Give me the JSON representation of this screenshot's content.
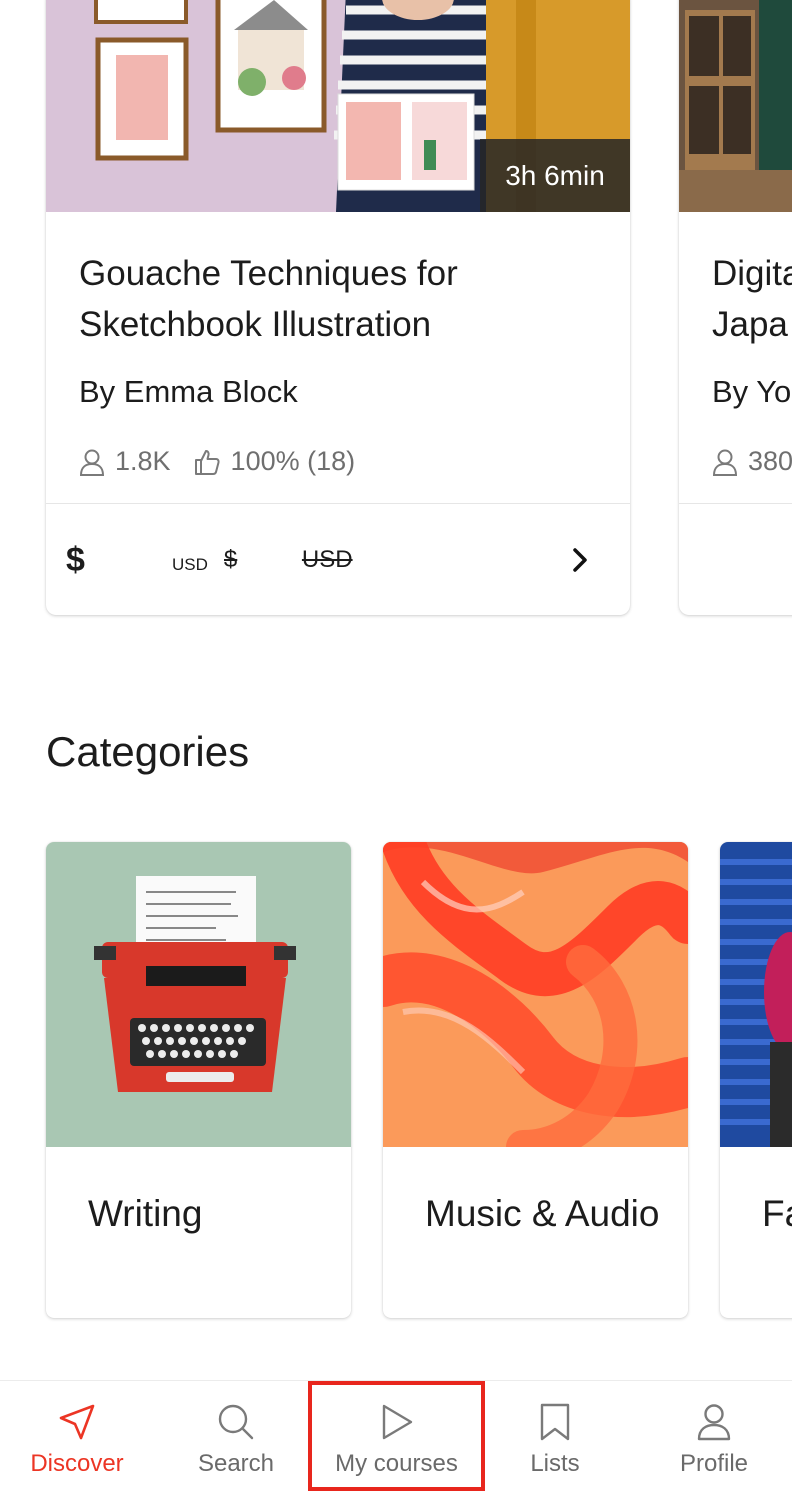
{
  "courses": [
    {
      "duration": "3h 6min",
      "title": "Gouache Techniques for Sketchbook Illustration",
      "author": "By Emma Block",
      "students": "1.8K",
      "rating": "100% (18)",
      "price_prefix": "$",
      "price_currency": "USD",
      "old_price_prefix": "$",
      "old_price_currency": "USD"
    },
    {
      "title_line1": "Digita",
      "title_line2": "Japa",
      "author": "By Yo",
      "students": "380"
    }
  ],
  "categories_title": "Categories",
  "categories": [
    {
      "label": "Writing"
    },
    {
      "label": "Music & Audio"
    },
    {
      "label": "Fa"
    }
  ],
  "nav": {
    "discover": "Discover",
    "search": "Search",
    "my_courses": "My courses",
    "lists": "Lists",
    "profile": "Profile"
  },
  "colors": {
    "accent": "#ec3524",
    "highlight_box": "#e8261d"
  }
}
